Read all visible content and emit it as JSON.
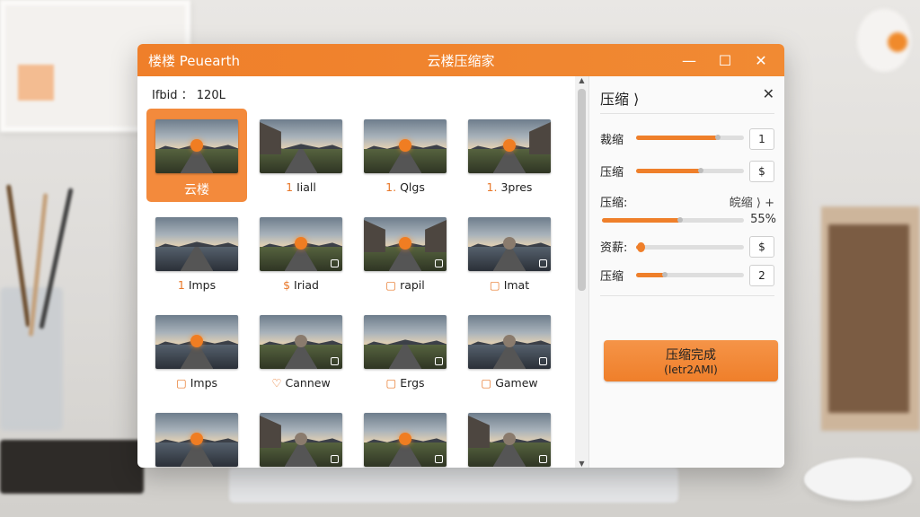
{
  "titlebar": {
    "app_name": "楼楼 Peuearth",
    "window_title": "云楼压缩家",
    "minimize": "—",
    "maximize": "☐",
    "close": "✕"
  },
  "gallery": {
    "header": "Ifbid ： 120L",
    "tiles": [
      {
        "caption": "云楼",
        "icon": ""
      },
      {
        "caption": "Iiall",
        "icon": "1"
      },
      {
        "caption": "Qlgs",
        "icon": "1."
      },
      {
        "caption": "3pres",
        "icon": "1."
      },
      {
        "caption": "Imps",
        "icon": "1"
      },
      {
        "caption": "Iriad",
        "icon": "$"
      },
      {
        "caption": "rapil",
        "icon": "▢"
      },
      {
        "caption": "Imat",
        "icon": "▢"
      },
      {
        "caption": "Imps",
        "icon": "▢"
      },
      {
        "caption": "Cannew",
        "icon": "♡"
      },
      {
        "caption": "Ergs",
        "icon": "▢"
      },
      {
        "caption": "Gamew",
        "icon": "▢"
      },
      {
        "caption": "",
        "icon": ""
      },
      {
        "caption": "",
        "icon": ""
      },
      {
        "caption": "",
        "icon": ""
      },
      {
        "caption": "",
        "icon": ""
      }
    ]
  },
  "panel": {
    "title": "压缩 ⟩",
    "close": "✕",
    "rows": [
      {
        "label": "裁缩",
        "value": 0.76,
        "stepper": "1"
      },
      {
        "label": "压缩",
        "value": 0.6,
        "stepper": "$"
      },
      {
        "label": "压缩:",
        "mode": "皖缩 ⟩ +",
        "value": 0.55,
        "percent": "55%"
      },
      {
        "label": "资薪:",
        "value": 0.04,
        "stepper": "$"
      },
      {
        "label": "压缩",
        "value": 0.27,
        "stepper": "2"
      }
    ],
    "done_button": {
      "line1": "压缩完成",
      "line2": "(Ietr2AMI)"
    }
  },
  "colors": {
    "accent": "#ef7f2a",
    "selected_tile": "#f38a3c"
  }
}
